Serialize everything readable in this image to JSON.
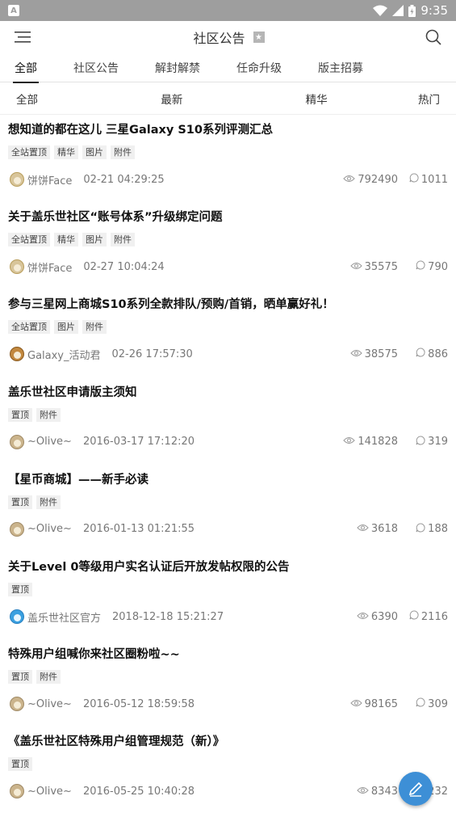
{
  "status": {
    "time": "9:35",
    "notification_glyph": "A"
  },
  "header": {
    "title": "社区公告"
  },
  "tabs": [
    {
      "label": "全部",
      "active": true
    },
    {
      "label": "社区公告"
    },
    {
      "label": "解封解禁"
    },
    {
      "label": "任命升级"
    },
    {
      "label": "版主招募"
    }
  ],
  "filters": [
    "全部",
    "最新",
    "精华",
    "热门"
  ],
  "posts": [
    {
      "title": "想知道的都在这儿 三星Galaxy S10系列评测汇总",
      "tags": [
        "全站置顶",
        "精华",
        "图片",
        "附件"
      ],
      "author": "饼饼Face",
      "date": "02-21 04:29:25",
      "views": "792490",
      "replies": "1011"
    },
    {
      "title": "关于盖乐世社区“账号体系”升级绑定问题",
      "tags": [
        "全站置顶",
        "精华",
        "图片",
        "附件"
      ],
      "author": "饼饼Face",
      "date": "02-27 10:04:24",
      "views": "35575",
      "replies": "790"
    },
    {
      "title": "参与三星网上商城S10系列全款排队/预购/首销，晒单赢好礼！",
      "tags": [
        "全站置顶",
        "图片",
        "附件"
      ],
      "author": "Galaxy_活动君",
      "date": "02-26 17:57:30",
      "views": "38575",
      "replies": "886"
    },
    {
      "title": "盖乐世社区申请版主须知",
      "tags": [
        "置顶",
        "附件"
      ],
      "author": "~Olive~",
      "date": "2016-03-17 17:12:20",
      "views": "141828",
      "replies": "319"
    },
    {
      "title": "【星币商城】——新手必读",
      "tags": [
        "置顶",
        "附件"
      ],
      "author": "~Olive~",
      "date": "2016-01-13 01:21:55",
      "views": "3618",
      "replies": "188"
    },
    {
      "title": "关于Level 0等级用户实名认证后开放发帖权限的公告",
      "tags": [
        "置顶"
      ],
      "author": "盖乐世社区官方",
      "date": "2018-12-18 15:21:27",
      "views": "6390",
      "replies": "2116"
    },
    {
      "title": "特殊用户组喊你来社区圈粉啦~~",
      "tags": [
        "置顶",
        "附件"
      ],
      "author": "~Olive~",
      "date": "2016-05-12 18:59:58",
      "views": "98165",
      "replies": "309"
    },
    {
      "title": "《盖乐世社区特殊用户组管理规范（新）》",
      "tags": [
        "置顶"
      ],
      "author": "~Olive~",
      "date": "2016-05-25 10:40:28",
      "views": "8343",
      "replies": "232"
    }
  ],
  "icons": {
    "menu": "menu-icon",
    "search": "search-icon",
    "star": "star-icon",
    "eye": "eye-icon",
    "bubble": "reply-bubble-icon",
    "fab": "pencil-icon"
  },
  "colors": {
    "statusbar": "#9e9e9e",
    "fab": "#3d8fd6"
  }
}
